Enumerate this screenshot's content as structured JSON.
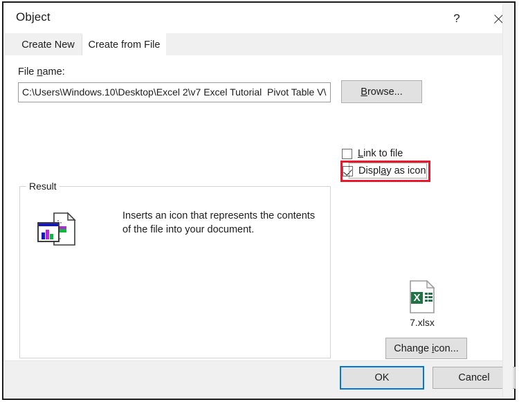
{
  "window": {
    "title": "Object",
    "help_label": "?",
    "close_label": "×"
  },
  "tabs": [
    {
      "label": "Create New",
      "active": false
    },
    {
      "label": "Create from File",
      "active": true
    }
  ],
  "file_section": {
    "label_prefix": "File ",
    "label_accel": "n",
    "label_suffix": "ame:",
    "path_value": "C:\\Users\\Windows.10\\Desktop\\Excel 2\\v7 Excel Tutorial  Pivot Table V\\رج",
    "placeholder": "",
    "browse_prefix": "",
    "browse_accel": "B",
    "browse_suffix": "rowse..."
  },
  "options": {
    "link_to_file": {
      "label_prefix": "",
      "label_accel": "L",
      "label_suffix": "ink to file",
      "checked": false
    },
    "display_as_icon": {
      "label_prefix": "Displ",
      "label_accel": "a",
      "label_suffix": "y as icon",
      "checked": true,
      "focused": true,
      "highlight_color": "#e8192c"
    }
  },
  "result": {
    "group_label": "Result",
    "description": "Inserts an icon that represents the contents of the file into your document."
  },
  "preview": {
    "file_name": "7.xlsx",
    "icon_color": "#217346"
  },
  "buttons": {
    "change_icon_prefix": "Change ",
    "change_icon_accel": "i",
    "change_icon_suffix": "con...",
    "ok": "OK",
    "cancel": "Cancel"
  }
}
